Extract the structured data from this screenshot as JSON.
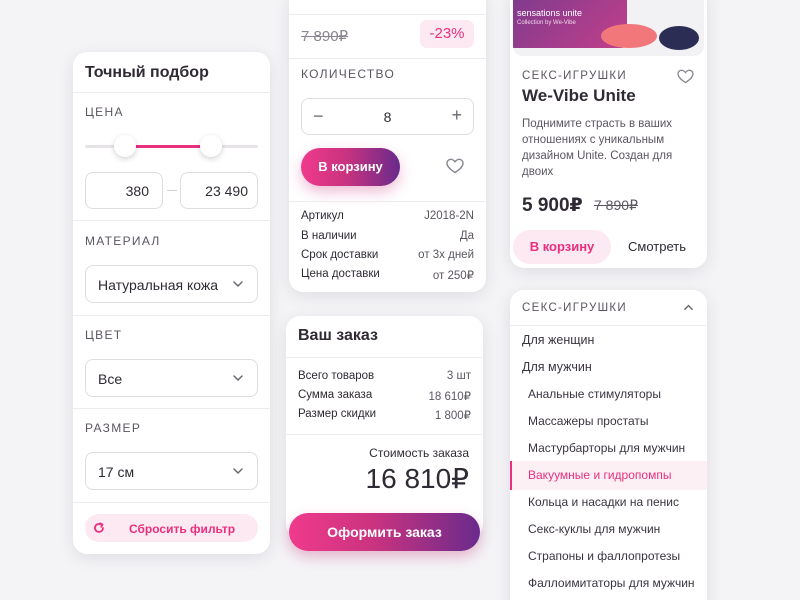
{
  "filter": {
    "title": "Точный подбор",
    "price_label": "ЦЕНА",
    "price_min": "380",
    "price_max": "23 490",
    "material_label": "МАТЕРИАЛ",
    "material_value": "Натуральная кожа",
    "color_label": "ЦВЕТ",
    "color_value": "Все",
    "size_label": "РАЗМЕР",
    "size_value": "17 см",
    "reset_label": "Сбросить фильтр"
  },
  "product_detail": {
    "old_price": "7 890₽",
    "discount": "-23%",
    "qty_label": "КОЛИЧЕСТВО",
    "qty_minus": "−",
    "qty_value": "8",
    "qty_plus": "+",
    "cart_label": "В корзину",
    "specs": [
      {
        "k": "Артикул",
        "v": "J2018-2N"
      },
      {
        "k": "В наличии",
        "v": "Да"
      },
      {
        "k": "Срок доставки",
        "v": "от 3х дней"
      },
      {
        "k": "Цена доставки",
        "v": "от 250₽"
      }
    ]
  },
  "order": {
    "title": "Ваш заказ",
    "rows": [
      {
        "k": "Всего товаров",
        "v": "3 шт"
      },
      {
        "k": "Сумма заказа",
        "v": "18 610₽"
      },
      {
        "k": "Размер скидки",
        "v": "1 800₽"
      }
    ],
    "total_label": "Стоимость заказа",
    "total_value": "16 810₽",
    "checkout_label": "Оформить заказ"
  },
  "product_card": {
    "image_text_1": "sensations unite",
    "image_text_2": "Collection by We-Vibe",
    "category": "СЕКС-ИГРУШКИ",
    "name": "We-Vibe Unite",
    "description": "Поднимите страсть в ваших отношениях с уникальным дизайном Unite. Создан для двоих",
    "price": "5 900₽",
    "old_price": "7 890₽",
    "cart_label": "В корзину",
    "view_label": "Смотреть"
  },
  "categories": {
    "title": "СЕКС-ИГРУШКИ",
    "items": [
      {
        "label": "Для женщин"
      },
      {
        "label": "Для мужчин"
      },
      {
        "label": "Анальные стимуляторы"
      },
      {
        "label": "Массажеры простаты"
      },
      {
        "label": "Мастурбарторы для мужчин"
      },
      {
        "label": "Вакуумные и гидропомпы",
        "active": true
      },
      {
        "label": "Кольца и насадки на пенис"
      },
      {
        "label": "Секс-куклы для мужчин"
      },
      {
        "label": "Страпоны и фаллопротезы"
      },
      {
        "label": "Фаллоимитаторы для мужчин"
      }
    ]
  },
  "colors": {
    "accent": "#e8307f",
    "purple": "#6a2a8c",
    "text": "#2f2a33",
    "muted": "#5b5560",
    "background": "#f4f4f6"
  },
  "icons": [
    "chevron-down-icon",
    "chevron-up-icon",
    "heart-icon",
    "reset-icon",
    "minus-icon",
    "plus-icon"
  ]
}
